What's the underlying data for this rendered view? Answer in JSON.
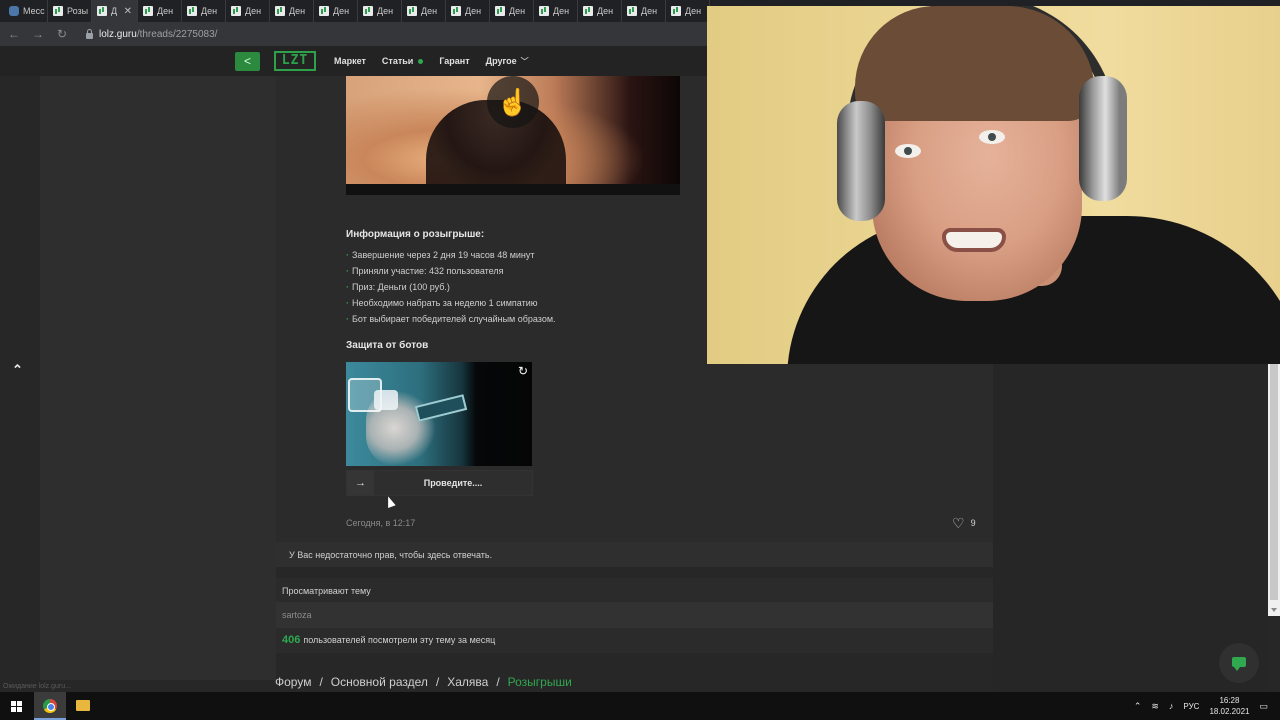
{
  "browser": {
    "tabs": [
      {
        "label": "Меcс",
        "icon": "vk-icon"
      },
      {
        "label": "Розы",
        "icon": "lolz-icon"
      },
      {
        "label": "Д",
        "icon": "lolz-icon",
        "active": true
      },
      {
        "label": "Ден",
        "icon": "lolz-icon"
      },
      {
        "label": "Ден",
        "icon": "lolz-icon"
      },
      {
        "label": "Ден",
        "icon": "lolz-icon"
      },
      {
        "label": "Ден",
        "icon": "lolz-icon"
      },
      {
        "label": "Ден",
        "icon": "lolz-icon"
      },
      {
        "label": "Ден",
        "icon": "lolz-icon"
      },
      {
        "label": "Ден",
        "icon": "lolz-icon"
      },
      {
        "label": "Ден",
        "icon": "lolz-icon"
      },
      {
        "label": "Ден",
        "icon": "lolz-icon"
      },
      {
        "label": "Ден",
        "icon": "lolz-icon"
      },
      {
        "label": "Ден",
        "icon": "lolz-icon"
      },
      {
        "label": "Ден",
        "icon": "lolz-icon"
      },
      {
        "label": "Ден",
        "icon": "lolz-icon"
      }
    ],
    "active_tab_close": "✕",
    "url_host": "lolz.guru",
    "url_path": "/threads/2275083/"
  },
  "site": {
    "logo": "LZT",
    "menu": {
      "market": "Маркет",
      "articles": "Статьи",
      "guarantor": "Гарант",
      "other": "Другое"
    }
  },
  "post": {
    "info_title": "Информация о розыгрыше:",
    "info_items": [
      "Завершение через 2 дня 19 часов 48 минут",
      "Приняли участие: 432 пользователя",
      "Приз: Деньги (100 руб.)",
      "Необходимо набрать за неделю 1 симпатию",
      "Бот выбирает победителей случайным образом."
    ],
    "protection_title": "Защита от ботов",
    "slider_label": "Проведите....",
    "time": "Сегодня, в 12:17",
    "likes": "9"
  },
  "no_reply_text": "У Вас недостаточно прав, чтобы здесь отвечать.",
  "viewers": {
    "title": "Просматривают тему",
    "users": "sartoza",
    "count": "406",
    "count_text": "пользователей посмотрели эту тему за месяц"
  },
  "breadcrumb": {
    "items": [
      "Форум",
      "Основной раздел",
      "Халява"
    ],
    "current": "Розыгрыши",
    "separator": "/"
  },
  "status_hint": "Ожидание lolz.guru...",
  "taskbar": {
    "lang": "РУС",
    "time": "16:28",
    "date": "18.02.2021"
  },
  "colors": {
    "accent": "#2fa84f",
    "background": "#272727"
  }
}
